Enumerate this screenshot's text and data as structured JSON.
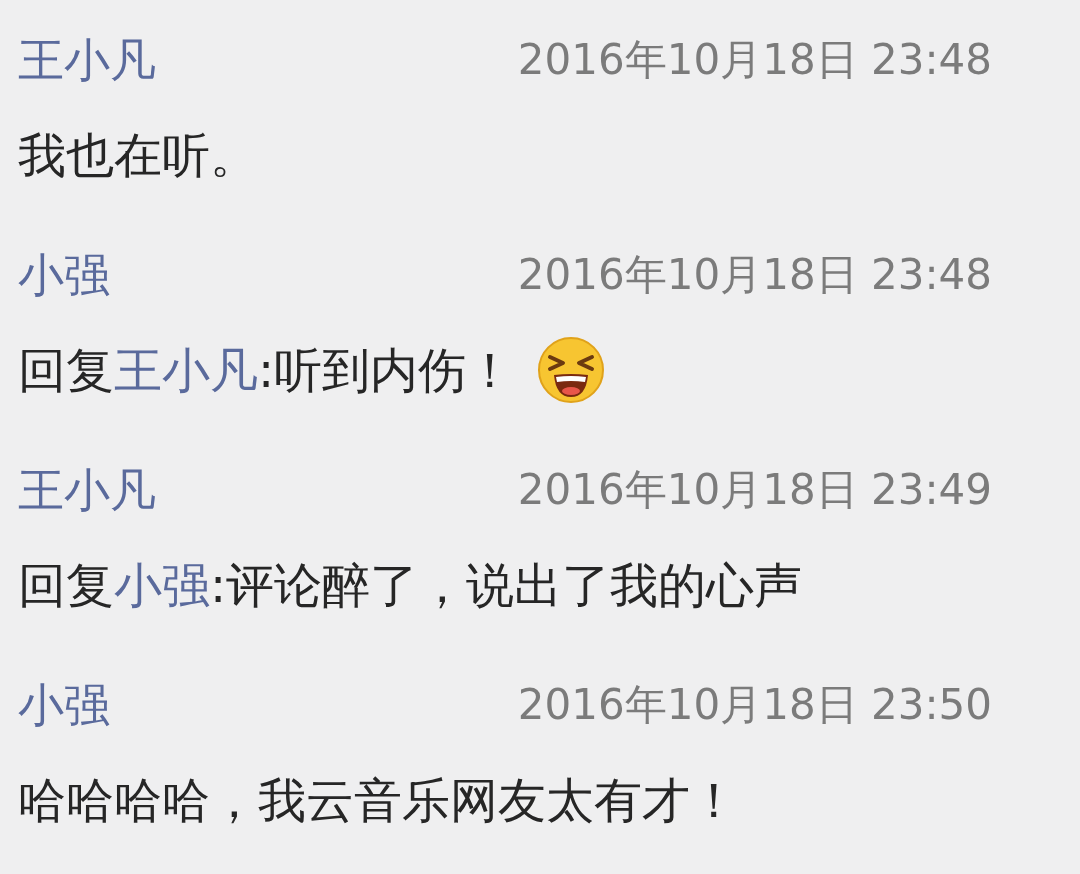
{
  "comments": [
    {
      "author": "王小凡",
      "time": "2016年10月18日 23:48",
      "text": "我也在听。"
    },
    {
      "author": "小强",
      "time": "2016年10月18日 23:48",
      "reply_prefix": "回复",
      "reply_to": "王小凡",
      "text": ":听到内伤！",
      "emoji": true
    },
    {
      "author": "王小凡",
      "time": "2016年10月18日 23:49",
      "reply_prefix": "回复",
      "reply_to": "小强",
      "text": ":评论醉了，说出了我的心声"
    },
    {
      "author": "小强",
      "time": "2016年10月18日 23:50",
      "text": "哈哈哈哈，我云音乐网友太有才！"
    }
  ]
}
